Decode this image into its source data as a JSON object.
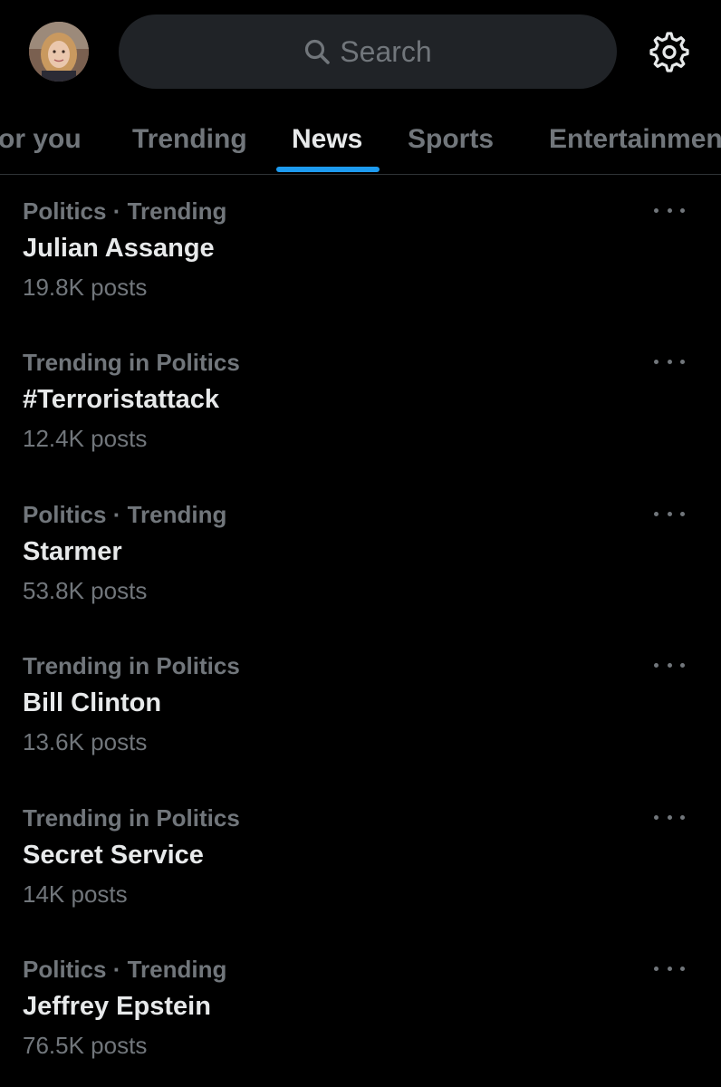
{
  "search": {
    "placeholder": "Search"
  },
  "tabs": [
    {
      "label": "or you",
      "active": false
    },
    {
      "label": "Trending",
      "active": false
    },
    {
      "label": "News",
      "active": true
    },
    {
      "label": "Sports",
      "active": false
    },
    {
      "label": "Entertainmen",
      "active": false
    }
  ],
  "trends": [
    {
      "context": "Politics · Trending",
      "name": "Julian Assange",
      "count": "19.8K posts"
    },
    {
      "context": "Trending in Politics",
      "name": "#Terroristattack",
      "count": "12.4K posts"
    },
    {
      "context": "Politics · Trending",
      "name": "Starmer",
      "count": "53.8K posts"
    },
    {
      "context": "Trending in Politics",
      "name": "Bill Clinton",
      "count": "13.6K posts"
    },
    {
      "context": "Trending in Politics",
      "name": "Secret Service",
      "count": "14K posts"
    },
    {
      "context": "Politics · Trending",
      "name": "Jeffrey Epstein",
      "count": "76.5K posts"
    }
  ],
  "icons": {
    "search": "search-icon",
    "settings": "gear-icon",
    "more": "more-icon"
  },
  "colors": {
    "background": "#000000",
    "accent": "#1d9bf0",
    "primary_text": "#e7e9ea",
    "secondary_text": "#71767b",
    "search_bg": "#202327"
  }
}
